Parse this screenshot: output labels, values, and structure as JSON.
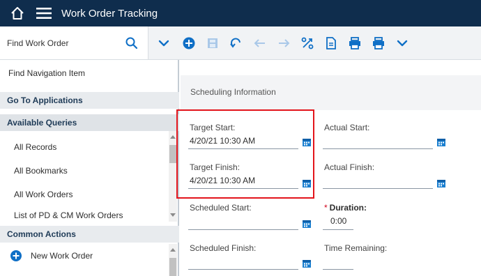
{
  "app": {
    "title": "Work Order Tracking"
  },
  "toolbar": {
    "find_placeholder": "Find Work Order",
    "icons": [
      "add-icon",
      "save-icon",
      "undo-icon",
      "previous-icon",
      "next-icon",
      "workflow-icon",
      "document-icon",
      "print-icon",
      "print-alt-icon",
      "more-chevron-icon"
    ]
  },
  "sidebar": {
    "find_navigation": "Find Navigation Item",
    "go_to_applications": "Go To Applications",
    "available_queries": "Available Queries",
    "queries": [
      "All Records",
      "All Bookmarks",
      "All Work Orders",
      "List of PD & CM Work Orders"
    ],
    "common_actions": "Common Actions",
    "actions": [
      {
        "label": "New Work Order",
        "icon": "add-circle-icon"
      }
    ]
  },
  "main": {
    "section_title": "Scheduling Information",
    "fields": {
      "target_start": {
        "label": "Target Start:",
        "value": "4/20/21 10:30 AM"
      },
      "target_finish": {
        "label": "Target Finish:",
        "value": "4/20/21 10:30 AM"
      },
      "actual_start": {
        "label": "Actual Start:",
        "value": ""
      },
      "actual_finish": {
        "label": "Actual Finish:",
        "value": ""
      },
      "scheduled_start": {
        "label": "Scheduled Start:",
        "value": ""
      },
      "scheduled_finish": {
        "label": "Scheduled Finish:",
        "value": ""
      },
      "duration": {
        "required_mark": "*",
        "label": "Duration:",
        "value": "0:00"
      },
      "time_remaining": {
        "label": "Time Remaining:",
        "value": ""
      }
    }
  },
  "colors": {
    "topbar": "#0f2d4d",
    "accent": "#0f6fc6",
    "highlight": "#e3141b",
    "header_bg": "#e8ebee"
  }
}
